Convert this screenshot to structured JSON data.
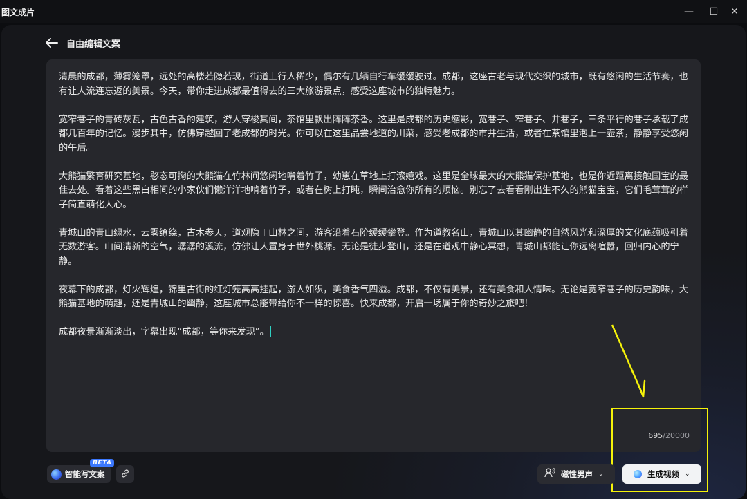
{
  "window": {
    "title": "图文成片",
    "minimize_symbol": "—",
    "maximize_symbol": "☐",
    "close_symbol": "✕"
  },
  "header": {
    "back_icon": "arrow-left-icon",
    "title": "自由编辑文案"
  },
  "editor": {
    "paragraphs": [
      "清晨的成都，薄雾笼罩，远处的高楼若隐若现，街道上行人稀少，偶尔有几辆自行车缓缓驶过。成都，这座古老与现代交织的城市，既有悠闲的生活节奏，也有让人流连忘返的美景。今天，带你走进成都最值得去的三大旅游景点，感受这座城市的独特魅力。",
      "宽窄巷子的青砖灰瓦，古色古香的建筑，游人穿梭其间，茶馆里飘出阵阵茶香。这里是成都的历史缩影，宽巷子、窄巷子、井巷子，三条平行的巷子承载了成都几百年的记忆。漫步其中，仿佛穿越回了老成都的时光。你可以在这里品尝地道的川菜，感受老成都的市井生活，或者在茶馆里泡上一壶茶，静静享受悠闲的午后。",
      "大熊猫繁育研究基地，憨态可掬的大熊猫在竹林间悠闲地啃着竹子，幼崽在草地上打滚嬉戏。这里是全球最大的大熊猫保护基地，也是你近距离接触国宝的最佳去处。看着这些黑白相间的小家伙们懒洋洋地啃着竹子，或者在树上打盹，瞬间治愈你所有的烦恼。别忘了去看看刚出生不久的熊猫宝宝，它们毛茸茸的样子简直萌化人心。",
      "青城山的青山绿水，云雾缭绕，古木参天，道观隐于山林之间，游客沿着石阶缓缓攀登。作为道教名山，青城山以其幽静的自然风光和深厚的文化底蕴吸引着无数游客。山间清新的空气，潺潺的溪流，仿佛让人置身于世外桃源。无论是徒步登山，还是在道观中静心冥想，青城山都能让你远离喧嚣，回归内心的宁静。",
      "夜幕下的成都，灯火辉煌，锦里古街的红灯笼高高挂起，游人如织，美食香气四溢。成都，不仅有美景，还有美食和人情味。无论是宽窄巷子的历史韵味，大熊猫基地的萌趣，还是青城山的幽静，这座城市总能带给你不一样的惊喜。快来成都，开启一场属于你的奇妙之旅吧！",
      "成都夜景渐渐淡出，字幕出现“成都，等你来发现”。"
    ],
    "char_count": "695",
    "char_limit": "/20000"
  },
  "toolbar": {
    "ai_write_label": "智能写文案",
    "ai_badge": "BETA",
    "link_icon": "link-icon",
    "voice_icon": "person-voice-icon",
    "voice_label": "磁性男声",
    "voice_chevron": "⌄",
    "generate_label": "生成视频",
    "generate_chevron": "⌄"
  },
  "colors": {
    "annotation": "#f5f20a",
    "caret": "#2fd0c2",
    "beta_badge": "#3b78ff",
    "generate_button": "#f2f3f5"
  }
}
